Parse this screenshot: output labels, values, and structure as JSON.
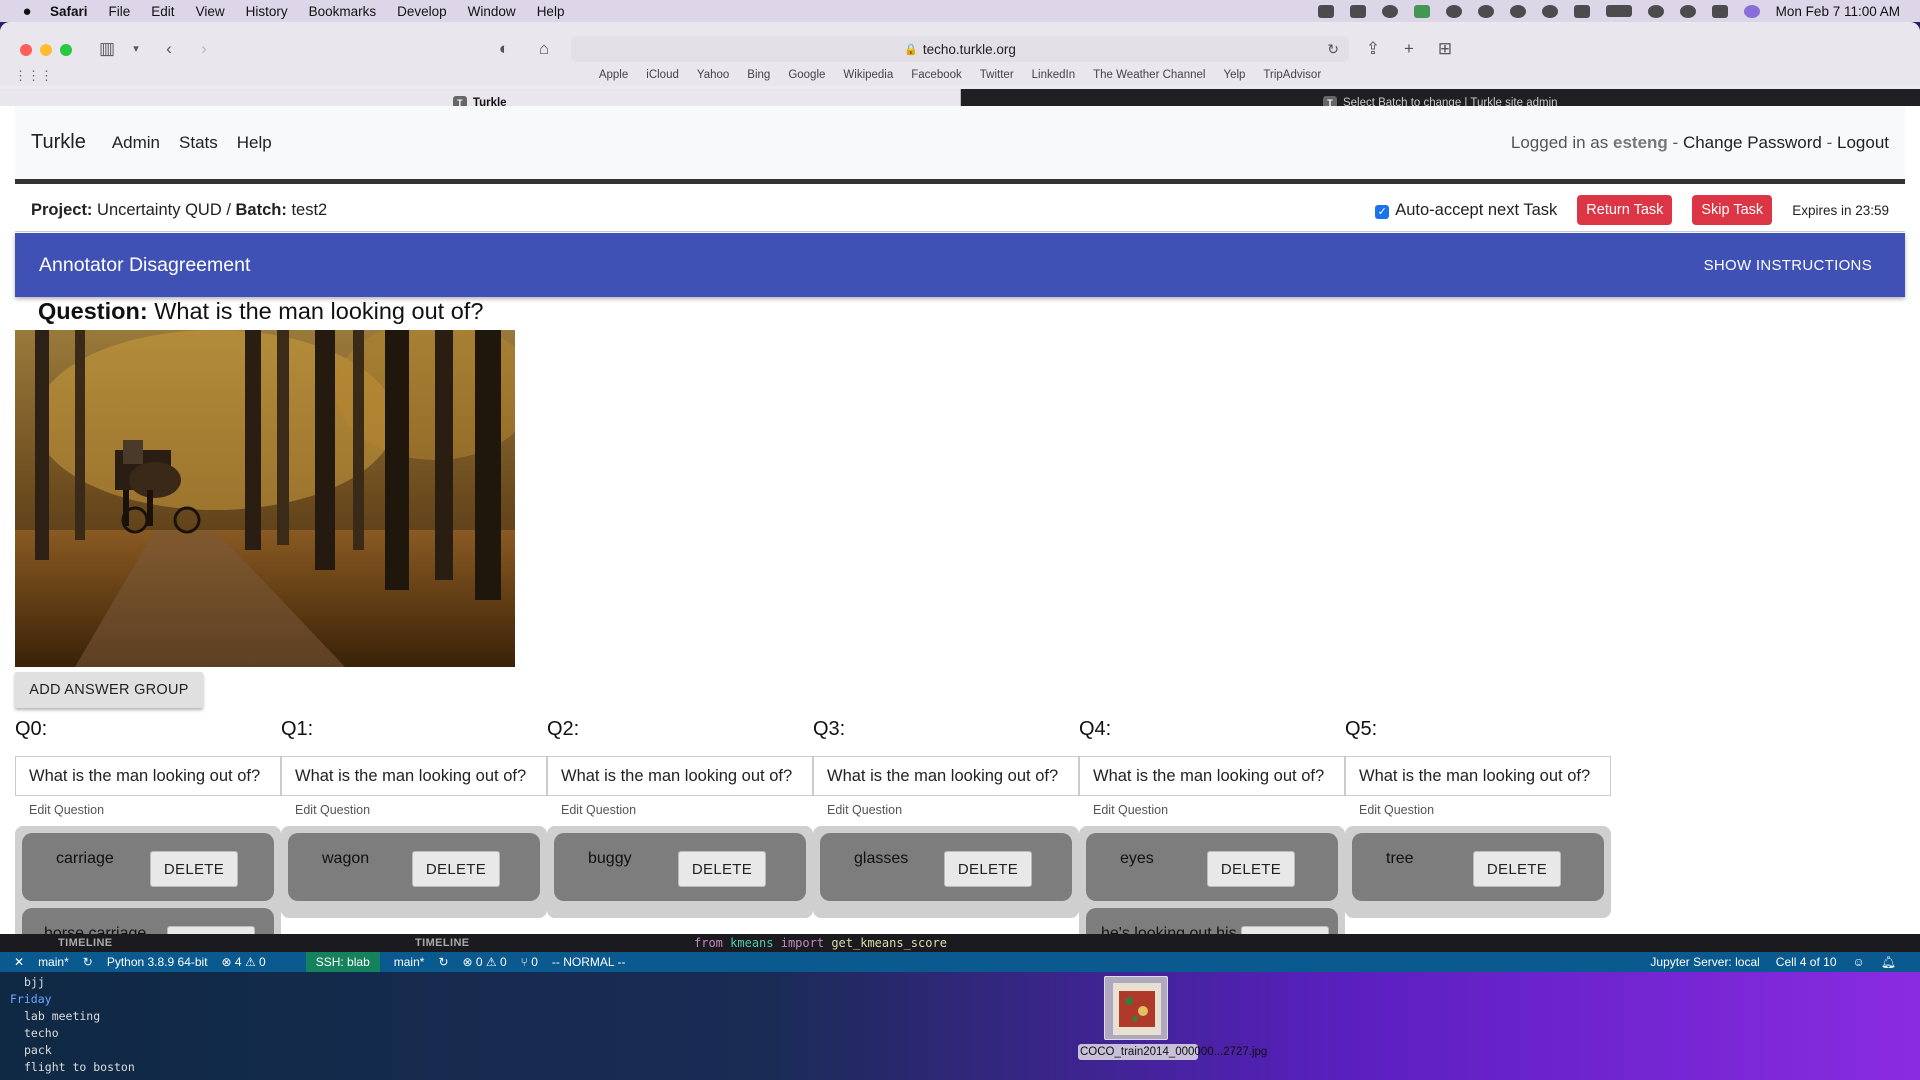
{
  "menubar": {
    "app": "Safari",
    "items": [
      "File",
      "Edit",
      "View",
      "History",
      "Bookmarks",
      "Develop",
      "Window",
      "Help"
    ],
    "clock": "Mon Feb 7  11:00 AM"
  },
  "browser": {
    "url": "techo.turkle.org",
    "favorites": [
      "Apple",
      "iCloud",
      "Yahoo",
      "Bing",
      "Google",
      "Wikipedia",
      "Facebook",
      "Twitter",
      "LinkedIn",
      "The Weather Channel",
      "Yelp",
      "TripAdvisor"
    ],
    "tabs": [
      {
        "favicon": "T",
        "title": "Turkle"
      },
      {
        "favicon": "T",
        "title": "Select Batch to change | Turkle site admin"
      }
    ]
  },
  "nav": {
    "brand": "Turkle",
    "links": [
      "Admin",
      "Stats",
      "Help"
    ],
    "logged_in_prefix": "Logged in as",
    "username": "esteng",
    "sep": "-",
    "change_password": "Change Password",
    "logout": "Logout"
  },
  "task": {
    "project_label": "Project:",
    "project": "Uncertainty QUD",
    "slash": "/",
    "batch_label": "Batch:",
    "batch": "test2",
    "auto_accept": "Auto-accept next Task",
    "return_task": "Return Task",
    "skip_task": "Skip Task",
    "expires": "Expires in 23:59"
  },
  "banner": {
    "title": "Annotator Disagreement",
    "show_instructions": "SHOW INSTRUCTIONS"
  },
  "question": {
    "label": "Question:",
    "text": "What is the man looking out of?"
  },
  "add_answer_group": "ADD ANSWER GROUP",
  "edit_question_label": "Edit Question",
  "delete_label": "DELETE",
  "groups": [
    {
      "label": "Q0:",
      "question": "What is the man looking out of?",
      "answers": [
        "carriage",
        "horse carriage"
      ]
    },
    {
      "label": "Q1:",
      "question": "What is the man looking out of?",
      "answers": [
        "wagon"
      ]
    },
    {
      "label": "Q2:",
      "question": "What is the man looking out of?",
      "answers": [
        "buggy"
      ]
    },
    {
      "label": "Q3:",
      "question": "What is the man looking out of?",
      "answers": [
        "glasses"
      ]
    },
    {
      "label": "Q4:",
      "question": "What is the man looking out of?",
      "answers": [
        "eyes",
        "he's looking out his"
      ]
    },
    {
      "label": "Q5:",
      "question": "What is the man looking out of?",
      "answers": [
        "tree"
      ]
    }
  ],
  "vscode": {
    "timeline_label": "TIMELINE",
    "code_line": {
      "kw1": "from",
      "module": "kmeans",
      "kw2": "import",
      "func": "get_kmeans_score"
    },
    "status_left": {
      "branch": "main*",
      "python": "Python 3.8.9 64-bit",
      "problems": "⊗ 4 ⚠ 0",
      "ssh": "SSH: blab",
      "branch2": "main*",
      "problems2": "⊗ 0 ⚠ 0",
      "ports": "⑂ 0",
      "mode": "-- NORMAL --"
    },
    "status_right": {
      "jupyter": "Jupyter Server: local",
      "cell": "Cell 4 of 10"
    }
  },
  "terminal": {
    "lines": [
      "bjj"
    ],
    "day": "Friday",
    "items": [
      "lab meeting",
      "techo",
      "pack",
      "flight to boston"
    ]
  },
  "desktop_file": {
    "name": "COCO_train2014_000000...2727.jpg"
  }
}
